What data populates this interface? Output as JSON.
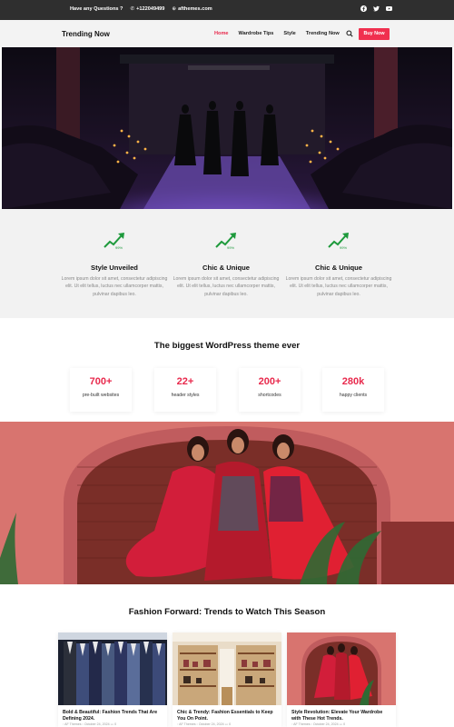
{
  "topbar": {
    "question": "Have any Questions ?",
    "phone": "+122049499",
    "site": "afthemes.com",
    "social": [
      "facebook-icon",
      "twitter-icon",
      "youtube-icon"
    ]
  },
  "header": {
    "logo": "Trending Now",
    "nav": [
      "Home",
      "Wardrobe Tips",
      "Style",
      "Trending Now"
    ],
    "buy_label": "Buy Now"
  },
  "features": [
    {
      "title": "Style Unveiled",
      "text": "Lorem ipsum dolor sit amet, consectetur adipiscing elit. Ut elit tellus, luctus nec ullamcorper mattis, pulvinar dapibus leo."
    },
    {
      "title": "Chic & Unique",
      "text": "Lorem ipsum dolor sit amet, consectetur adipiscing elit. Ut elit tellus, luctus nec ullamcorper mattis, pulvinar dapibus leo."
    },
    {
      "title": "Chic & Unique",
      "text": "Lorem ipsum dolor sit amet, consectetur adipiscing elit. Ut elit tellus, luctus nec ullamcorper mattis, pulvinar dapibus leo."
    }
  ],
  "stats": {
    "title": "The biggest WordPress theme ever",
    "items": [
      {
        "num": "700+",
        "label": "pre-built websites"
      },
      {
        "num": "22+",
        "label": "header styles"
      },
      {
        "num": "200+",
        "label": "shortcodes"
      },
      {
        "num": "280k",
        "label": "happy clients"
      }
    ]
  },
  "trends": {
    "title": "Fashion Forward: Trends to Watch This Season",
    "cards": [
      {
        "title": "Bold & Beautiful: Fashion Trends That Are Defining 2024.",
        "author": "AF Themes",
        "date": "October 24, 2024",
        "comments": "0"
      },
      {
        "title": "Chic & Trendy: Fashion Essentials to Keep You On Point.",
        "author": "AF Themes",
        "date": "October 24, 2024",
        "comments": "0"
      },
      {
        "title": "Style Revolution: Elevate Your Wardrobe with These Hot Trends.",
        "author": "AF Themes",
        "date": "October 24, 2024",
        "comments": "0"
      }
    ]
  },
  "colors": {
    "accent": "#e8294c",
    "topbar": "#2f2f2f",
    "feature_bg": "#f2f2f2",
    "icon_green": "#1e9a3c"
  }
}
